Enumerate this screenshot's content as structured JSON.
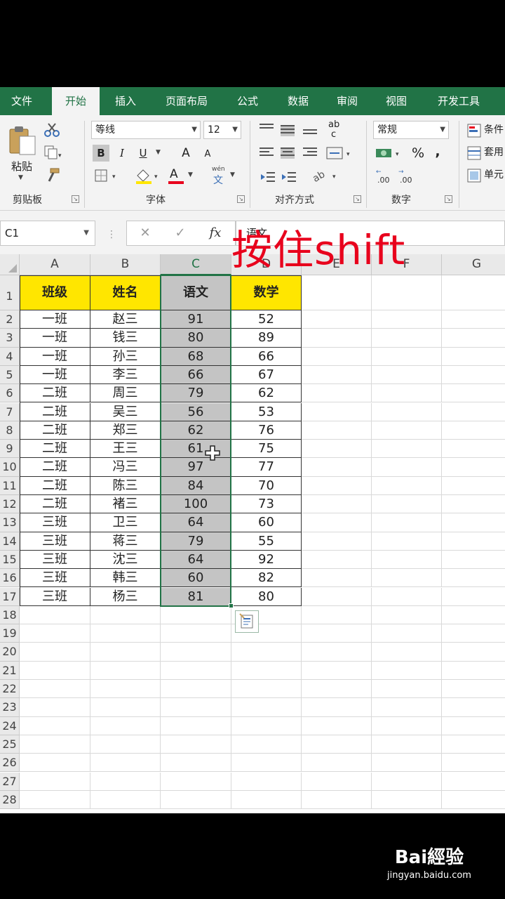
{
  "tabs": [
    {
      "label": "文件"
    },
    {
      "label": "开始"
    },
    {
      "label": "插入"
    },
    {
      "label": "页面布局"
    },
    {
      "label": "公式"
    },
    {
      "label": "数据"
    },
    {
      "label": "审阅"
    },
    {
      "label": "视图"
    },
    {
      "label": "开发工具"
    }
  ],
  "active_tab": "开始",
  "ribbon": {
    "clipboard": {
      "label": "剪贴板",
      "paste": "粘贴"
    },
    "font": {
      "label": "字体",
      "family": "等线",
      "size": "12",
      "bold": "B",
      "italic": "I",
      "underline": "U",
      "grow": "A",
      "shrink": "A",
      "font_color": "A",
      "phonetic_top": "wén",
      "phonetic_char": "文"
    },
    "align": {
      "label": "对齐方式",
      "wrap": "ab",
      "wrap_sub": "c"
    },
    "number": {
      "label": "数字",
      "format": "常规",
      "percent": "%",
      "comma": ",",
      "inc": ".00",
      "dec": ".00"
    },
    "styles": {
      "cond": "条件",
      "table": "套用",
      "cell": "单元"
    }
  },
  "formula_bar": {
    "name_box": "C1",
    "cancel": "✕",
    "enter": "✓",
    "fx": "fx",
    "content": "语文"
  },
  "grid": {
    "columns": [
      "A",
      "B",
      "C",
      "D",
      "E",
      "F",
      "G"
    ],
    "rows": [
      "1",
      "2",
      "3",
      "4",
      "5",
      "6",
      "7",
      "8",
      "9",
      "10",
      "11",
      "12",
      "13",
      "14",
      "15",
      "16",
      "17",
      "18",
      "19",
      "20",
      "21",
      "22",
      "23",
      "24",
      "25",
      "26",
      "27",
      "28"
    ],
    "headers": [
      "班级",
      "姓名",
      "语文",
      "数学"
    ],
    "data": [
      [
        "一班",
        "赵三",
        "91",
        "52"
      ],
      [
        "一班",
        "钱三",
        "80",
        "89"
      ],
      [
        "一班",
        "孙三",
        "68",
        "66"
      ],
      [
        "一班",
        "李三",
        "66",
        "67"
      ],
      [
        "二班",
        "周三",
        "79",
        "62"
      ],
      [
        "二班",
        "吴三",
        "56",
        "53"
      ],
      [
        "二班",
        "郑三",
        "62",
        "76"
      ],
      [
        "二班",
        "王三",
        "61",
        "75"
      ],
      [
        "二班",
        "冯三",
        "97",
        "77"
      ],
      [
        "二班",
        "陈三",
        "84",
        "70"
      ],
      [
        "二班",
        "褚三",
        "100",
        "73"
      ],
      [
        "三班",
        "卫三",
        "64",
        "60"
      ],
      [
        "三班",
        "蒋三",
        "79",
        "55"
      ],
      [
        "三班",
        "沈三",
        "64",
        "92"
      ],
      [
        "三班",
        "韩三",
        "60",
        "82"
      ],
      [
        "三班",
        "杨三",
        "81",
        "80"
      ]
    ],
    "selected_column": "C"
  },
  "overlay": "按住shift",
  "watermark": {
    "logo": "Bai經验",
    "url": "jingyan.baidu.com"
  },
  "colors": {
    "excel_green": "#217346",
    "header_yellow": "#ffe600",
    "overlay_red": "#e8001c"
  }
}
